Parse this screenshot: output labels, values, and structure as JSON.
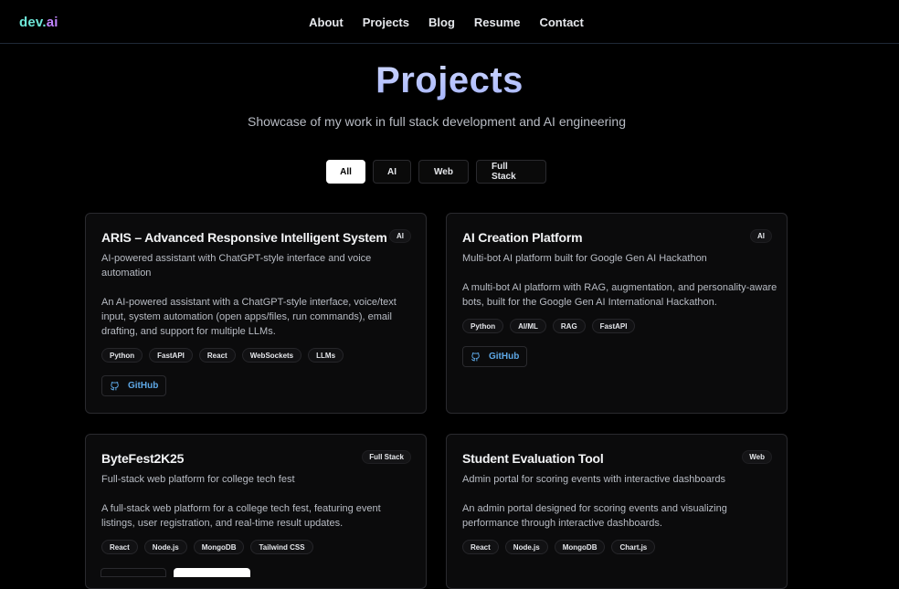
{
  "nav": {
    "logo_a": "dev.",
    "logo_b": "ai",
    "links": [
      "About",
      "Projects",
      "Blog",
      "Resume",
      "Contact"
    ]
  },
  "header": {
    "title": "Projects",
    "subtitle": "Showcase of my work in full stack development and AI engineering"
  },
  "filters": [
    "All",
    "AI",
    "Web",
    "Full Stack"
  ],
  "active_filter": "All",
  "projects": [
    {
      "title": "ARIS – Advanced Responsive Intelligent System",
      "badge": "AI",
      "short": "AI-powered assistant with ChatGPT-style interface and voice automation",
      "long": "An AI-powered assistant with a ChatGPT-style interface, voice/text input, system automation (open apps/files, run commands), email drafting, and support for multiple LLMs.",
      "tags": [
        "Python",
        "FastAPI",
        "React",
        "WebSockets",
        "LLMs"
      ],
      "github": "GitHub"
    },
    {
      "title": "AI Creation Platform",
      "badge": "AI",
      "short": "Multi-bot AI platform built for Google Gen AI Hackathon",
      "long": "A multi-bot AI platform with RAG, augmentation, and personality-aware bots, built for the Google Gen AI International Hackathon.",
      "tags": [
        "Python",
        "AI/ML",
        "RAG",
        "FastAPI"
      ],
      "github": "GitHub"
    },
    {
      "title": "ByteFest2K25",
      "badge": "Full Stack",
      "short": "Full-stack web platform for college tech fest",
      "long": "A full-stack web platform for a college tech fest, featuring event listings, user registration, and real-time result updates.",
      "tags": [
        "React",
        "Node.js",
        "MongoDB",
        "Tailwind CSS"
      ]
    },
    {
      "title": "Student Evaluation Tool",
      "badge": "Web",
      "short": "Admin portal for scoring events with interactive dashboards",
      "long": "An admin portal designed for scoring events and visualizing performance through interactive dashboards.",
      "tags": [
        "React",
        "Node.js",
        "MongoDB",
        "Chart.js"
      ]
    }
  ],
  "colors": {
    "background": "#000000",
    "card": "#0b0b0c",
    "border": "#2a2a2e",
    "logo_a": "#6ee7d8",
    "logo_b": "#c084fc",
    "title_gradient": "#a5b4fc",
    "github_link": "#5ea8e6"
  }
}
